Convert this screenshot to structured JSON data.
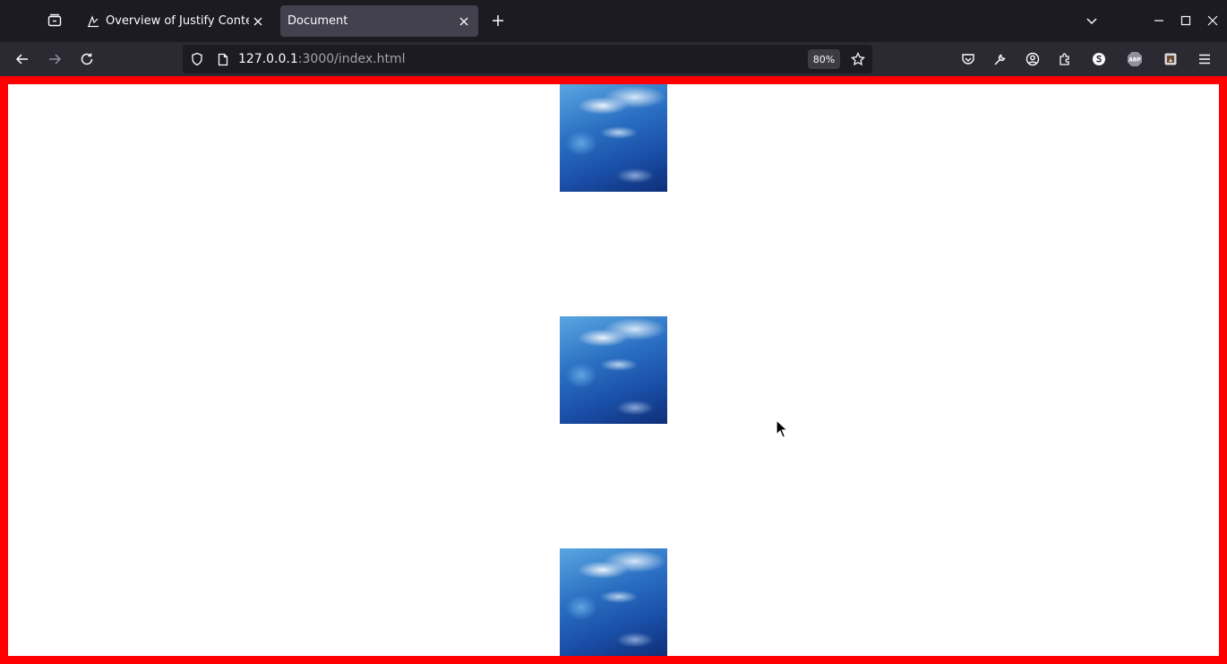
{
  "browser": {
    "tabs": [
      {
        "title": "Overview of Justify Content",
        "active": false
      },
      {
        "title": "Document",
        "active": true
      }
    ],
    "url": {
      "host": "127.0.0.1",
      "rest": ":3000/index.html"
    },
    "zoom": "80%"
  },
  "page": {
    "border_color": "#ff0000",
    "images": [
      {
        "name": "ocean-image-1",
        "alt": "ocean water"
      },
      {
        "name": "ocean-image-2",
        "alt": "ocean water"
      },
      {
        "name": "ocean-image-3",
        "alt": "ocean water"
      }
    ]
  }
}
